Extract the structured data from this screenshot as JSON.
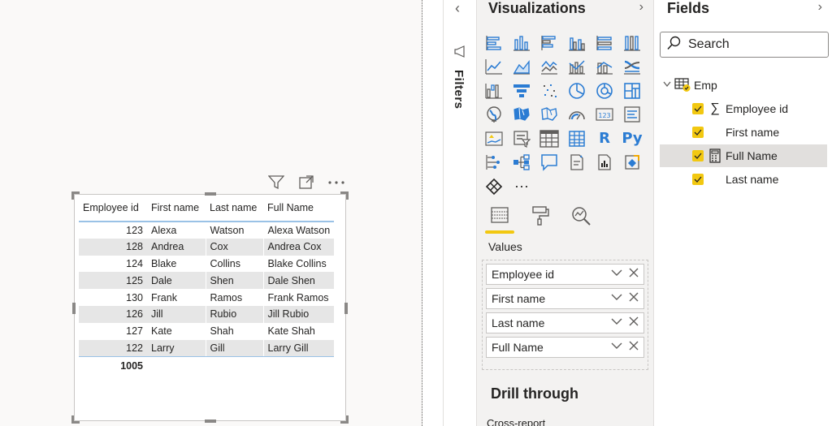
{
  "canvas": {
    "table": {
      "columns": [
        "Employee id",
        "First name",
        "Last name",
        "Full Name"
      ],
      "rows": [
        [
          "123",
          "Alexa",
          "Watson",
          "Alexa Watson"
        ],
        [
          "128",
          "Andrea",
          "Cox",
          "Andrea Cox"
        ],
        [
          "124",
          "Blake",
          "Collins",
          "Blake Collins"
        ],
        [
          "125",
          "Dale",
          "Shen",
          "Dale Shen"
        ],
        [
          "130",
          "Frank",
          "Ramos",
          "Frank Ramos"
        ],
        [
          "126",
          "Jill",
          "Rubio",
          "Jill Rubio"
        ],
        [
          "127",
          "Kate",
          "Shah",
          "Kate Shah"
        ],
        [
          "122",
          "Larry",
          "Gill",
          "Larry Gill"
        ]
      ],
      "total": "1005"
    },
    "visual_header_icons": [
      "filter-icon",
      "focus-mode-icon",
      "more-options-icon"
    ]
  },
  "filters": {
    "label": "Filters",
    "chevron": "‹"
  },
  "visualizations": {
    "title": "Visualizations",
    "chevron": "›",
    "icons": [
      "stacked-bar-icon",
      "stacked-column-icon",
      "clustered-bar-icon",
      "clustered-column-icon",
      "100-stacked-bar-icon",
      "100-stacked-column-icon",
      "line-chart-icon",
      "area-chart-icon",
      "stacked-area-icon",
      "line-clustered-column-icon",
      "line-stacked-column-icon",
      "ribbon-chart-icon",
      "waterfall-icon",
      "funnel-icon",
      "scatter-icon",
      "pie-chart-icon",
      "donut-chart-icon",
      "treemap-icon",
      "map-icon",
      "filled-map-icon",
      "shape-map-icon",
      "gauge-icon",
      "card-icon",
      "multi-row-card-icon",
      "kpi-icon",
      "slicer-icon",
      "table-icon",
      "matrix-icon",
      "r-visual-icon",
      "python-visual-icon",
      "key-influencers-icon",
      "decomposition-tree-icon",
      "qa-icon",
      "smart-narrative-icon",
      "paginated-report-icon",
      "power-apps-icon",
      "power-automate-icon",
      "more-visuals-icon"
    ],
    "r_label": "R",
    "py_label": "Py",
    "more_label": "···",
    "tabs": [
      "fields-tab-icon",
      "format-tab-icon",
      "analytics-tab-icon"
    ],
    "values_label": "Values",
    "values": [
      "Employee id",
      "First name",
      "Last name",
      "Full Name"
    ],
    "drill_through": "Drill through",
    "cross_report": "Cross-report"
  },
  "fields": {
    "title": "Fields",
    "chevron": "›",
    "search_placeholder": "Search",
    "table_name": "Emp",
    "items": [
      {
        "name": "Employee id",
        "type": "sigma",
        "checked": true
      },
      {
        "name": "First name",
        "type": "text",
        "checked": true
      },
      {
        "name": "Full Name",
        "type": "calculated",
        "checked": true,
        "selected": true
      },
      {
        "name": "Last name",
        "type": "text",
        "checked": true
      }
    ],
    "sigma_glyph": "∑"
  },
  "colors": {
    "accent_yellow": "#f2c811",
    "icon_blue": "#2b7cd3",
    "header_line": "#9ac2e6"
  }
}
